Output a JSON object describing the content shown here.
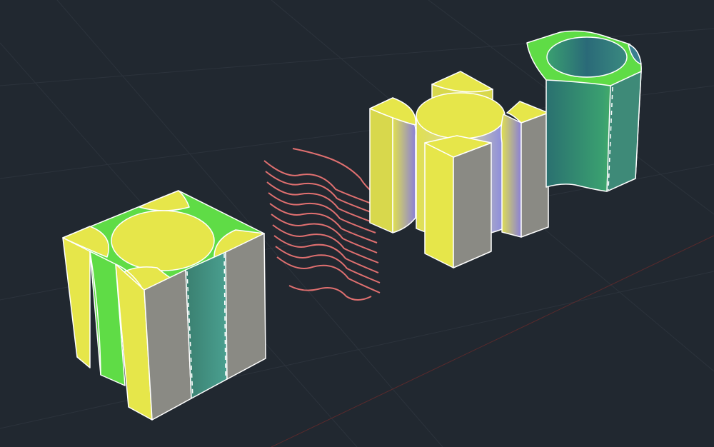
{
  "viewport": {
    "background": "#212830",
    "grid_color": "#2c333c",
    "axis_color": "#5a2a2c"
  },
  "colors": {
    "yellow": "#e6e64a",
    "yellow_side": "#d8d84c",
    "green": "#5fdc46",
    "teal": "#3e8a78",
    "gray": "#8a8a84",
    "edge": "#ffffff",
    "purple_shade": "#8a7ad8",
    "sweep_curve": "#e07070"
  },
  "objects": [
    {
      "name": "composite-cube-solid"
    },
    {
      "name": "swept-surface-curves"
    },
    {
      "name": "exploded-cylinder-solids"
    },
    {
      "name": "hollow-green-cylinder-solid"
    }
  ]
}
